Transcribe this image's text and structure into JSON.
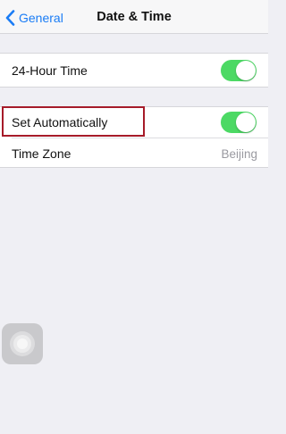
{
  "navbar": {
    "back_label": "General",
    "title": "Date & Time"
  },
  "settings": {
    "hour24": {
      "label": "24-Hour Time",
      "enabled": true
    },
    "set_automatically": {
      "label": "Set Automatically",
      "enabled": true
    },
    "time_zone": {
      "label": "Time Zone",
      "value": "Beijing"
    }
  },
  "colors": {
    "accent": "#1a7cf5",
    "toggle_on": "#4cd964",
    "highlight": "#a61b29",
    "background": "#efeff4"
  }
}
